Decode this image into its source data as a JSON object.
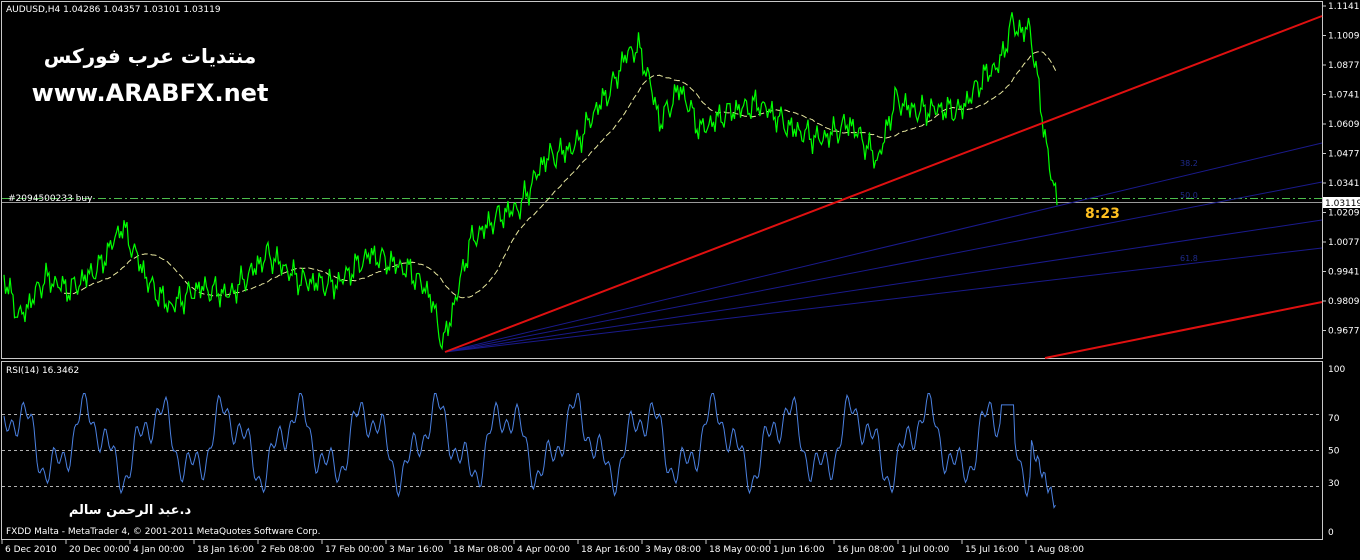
{
  "main_chart": {
    "header": "AUDUSD,H4  1.04286 1.04357 1.03101 1.03119",
    "watermark_arabic": "منتديات عرب فوركس",
    "watermark_url": "www.ARABFX.net",
    "order_label": "#2094500233 buy",
    "countdown": "8:23",
    "current_price": "1.03119",
    "fib_labels": [
      "38.2",
      "50.0",
      "61.8"
    ],
    "price_axis": [
      "1.11410",
      "1.10090",
      "1.08770",
      "1.07410",
      "1.06090",
      "1.04770",
      "1.03410",
      "1.02090",
      "1.00770",
      "0.99410",
      "0.98090",
      "0.96770"
    ]
  },
  "rsi_panel": {
    "header": "RSI(14) 16.3462",
    "axis": [
      "100",
      "70",
      "50",
      "30",
      "0"
    ],
    "author": "د.عبد الرحمن سالم",
    "copyright": "FXDD Malta - MetaTrader 4, © 2001-2011 MetaQuotes Software Corp."
  },
  "time_axis": [
    "6 Dec 2010",
    "20 Dec 00:00",
    "4 Jan 00:00",
    "18 Jan 16:00",
    "2 Feb 08:00",
    "17 Feb 00:00",
    "3 Mar 16:00",
    "18 Mar 08:00",
    "4 Apr 00:00",
    "18 Apr 16:00",
    "3 May 08:00",
    "18 May 00:00",
    "1 Jun 16:00",
    "16 Jun 08:00",
    "1 Jul 00:00",
    "15 Jul 16:00",
    "1 Aug 08:00"
  ],
  "colors": {
    "price_line": "#00ff00",
    "moving_average": "#e8e8a0",
    "trendline": "#e01010",
    "fan_lines": "#1a1a8c",
    "rsi_line": "#4a80e0",
    "countdown": "#ffc020"
  },
  "chart_data": [
    {
      "type": "line",
      "title": "AUDUSD,H4  1.04286 1.04357 1.03101 1.03119",
      "x": [
        "6 Dec 2010",
        "20 Dec 00:00",
        "4 Jan 00:00",
        "18 Jan 16:00",
        "2 Feb 08:00",
        "17 Feb 00:00",
        "3 Mar 16:00",
        "18 Mar 08:00",
        "4 Apr 00:00",
        "18 Apr 16:00",
        "3 May 08:00",
        "18 May 00:00",
        "1 Jun 16:00",
        "16 Jun 08:00",
        "1 Jul 00:00",
        "15 Jul 16:00",
        "1 Aug 08:00"
      ],
      "ylim": [
        0.9677,
        1.1141
      ],
      "series": [
        {
          "values": [
            0.99,
            0.99,
            1.015,
            0.99,
            1.0,
            1.003,
            1.005,
            0.97,
            1.022,
            1.06,
            1.095,
            1.065,
            1.058,
            1.058,
            1.063,
            1.098,
            1.0312
          ]
        }
      ]
    },
    {
      "type": "line",
      "title": "RSI(14) 16.3462",
      "ylim": [
        0,
        100
      ],
      "x": [
        "6 Dec 2010",
        "20 Dec 00:00",
        "4 Jan 00:00",
        "18 Jan 16:00",
        "2 Feb 08:00",
        "17 Feb 00:00",
        "3 Mar 16:00",
        "18 Mar 08:00",
        "4 Apr 00:00",
        "18 Apr 16:00",
        "3 May 08:00",
        "18 May 00:00",
        "1 Jun 16:00",
        "16 Jun 08:00",
        "1 Jul 00:00",
        "15 Jul 16:00",
        "1 Aug 08:00"
      ],
      "series": [
        {
          "values": [
            65,
            58,
            50,
            48,
            55,
            52,
            48,
            40,
            68,
            70,
            60,
            55,
            52,
            48,
            55,
            72,
            16.3
          ]
        }
      ]
    }
  ]
}
